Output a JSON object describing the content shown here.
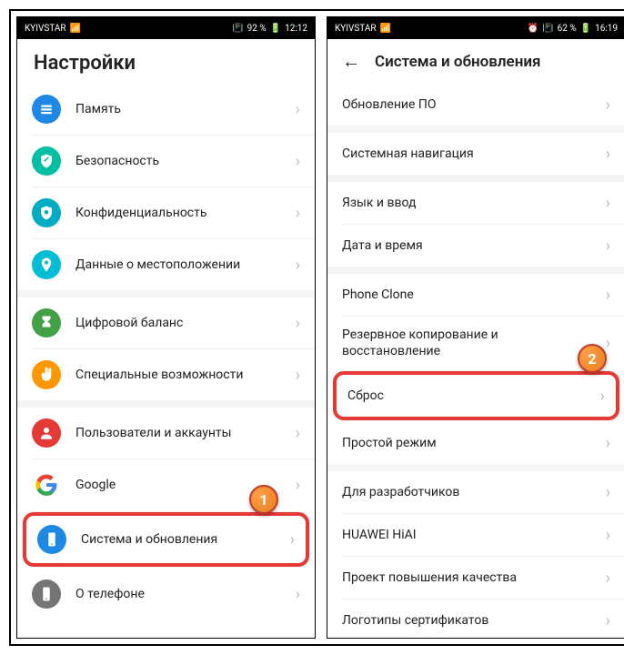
{
  "left": {
    "status": {
      "carrier": "KYIVSTAR",
      "battery": "92 %",
      "time": "12:12"
    },
    "title": "Настройки",
    "items": {
      "memory": "Память",
      "security": "Безопасность",
      "privacy": "Конфиденциальность",
      "location": "Данные о местоположении",
      "digital_balance": "Цифровой баланс",
      "accessibility": "Специальные возможности",
      "users": "Пользователи и аккаунты",
      "google": "Google",
      "system": "Система и обновления",
      "about": "О телефоне"
    },
    "callout": "1"
  },
  "right": {
    "status": {
      "carrier": "KYIVSTAR",
      "battery": "62 %",
      "time": "16:19"
    },
    "title": "Система и обновления",
    "items": {
      "update": "Обновление ПО",
      "nav": "Системная навигация",
      "lang": "Язык и ввод",
      "datetime": "Дата и время",
      "phoneclone": "Phone Clone",
      "backup": "Резервное копирование и восстановление",
      "reset": "Сброс",
      "simple": "Простой режим",
      "dev": "Для разработчиков",
      "hiai": "HUAWEI HiAI",
      "quality": "Проект повышения качества",
      "certs": "Логотипы сертификатов"
    },
    "callout": "2"
  }
}
